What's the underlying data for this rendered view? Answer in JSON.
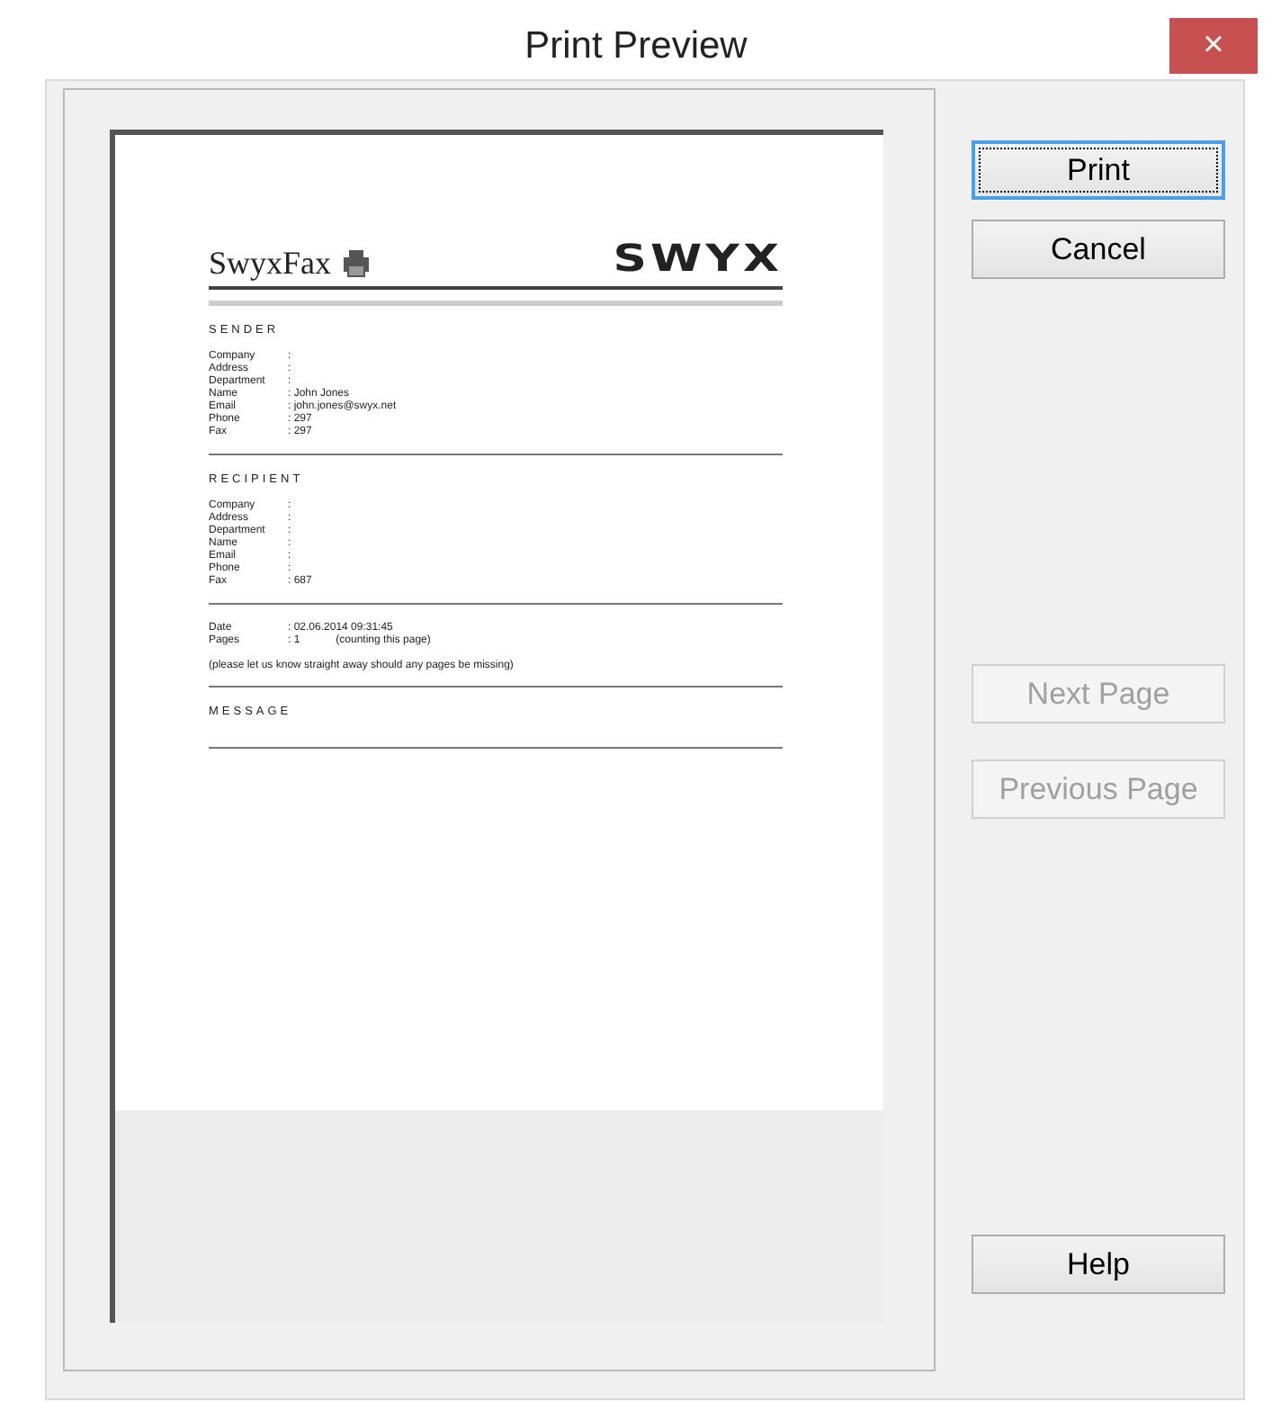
{
  "window": {
    "title": "Print Preview",
    "close": "×"
  },
  "page": {
    "brand": "SwyxFax",
    "logo": "SWYX",
    "sections": [
      {
        "heading": "SENDER",
        "fields": [
          {
            "label": "Company",
            "value": ":"
          },
          {
            "label": "Address",
            "value": ":"
          },
          {
            "label": "Department",
            "value": ":"
          },
          {
            "label": "Name",
            "value": ": John Jones"
          },
          {
            "label": "Email",
            "value": ": john.jones@swyx.net"
          },
          {
            "label": "Phone",
            "value": ": 297"
          },
          {
            "label": "Fax",
            "value": ": 297"
          }
        ]
      },
      {
        "heading": "RECIPIENT",
        "fields": [
          {
            "label": "Company",
            "value": ":"
          },
          {
            "label": "Address",
            "value": ":"
          },
          {
            "label": "Department",
            "value": ":"
          },
          {
            "label": "Name",
            "value": ":"
          },
          {
            "label": "Email",
            "value": ":"
          },
          {
            "label": "Phone",
            "value": ":"
          },
          {
            "label": "Fax",
            "value": ": 687"
          }
        ]
      },
      {
        "fields": [
          {
            "label": "Date",
            "value": ": 02.06.2014 09:31:45"
          },
          {
            "label": "Pages",
            "value": ": 1",
            "note": "(counting this page)"
          }
        ],
        "note": "(please let us know straight away should any pages be missing)"
      },
      {
        "heading": "MESSAGE"
      }
    ]
  },
  "buttons": [
    {
      "label": "Print",
      "focused": true,
      "disabled": false
    },
    {
      "label": "Cancel",
      "focused": false,
      "disabled": false
    },
    {
      "label": "Next Page",
      "focused": false,
      "disabled": true
    },
    {
      "label": "Previous Page",
      "focused": false,
      "disabled": true
    },
    {
      "label": "Help",
      "focused": false,
      "disabled": false
    }
  ]
}
